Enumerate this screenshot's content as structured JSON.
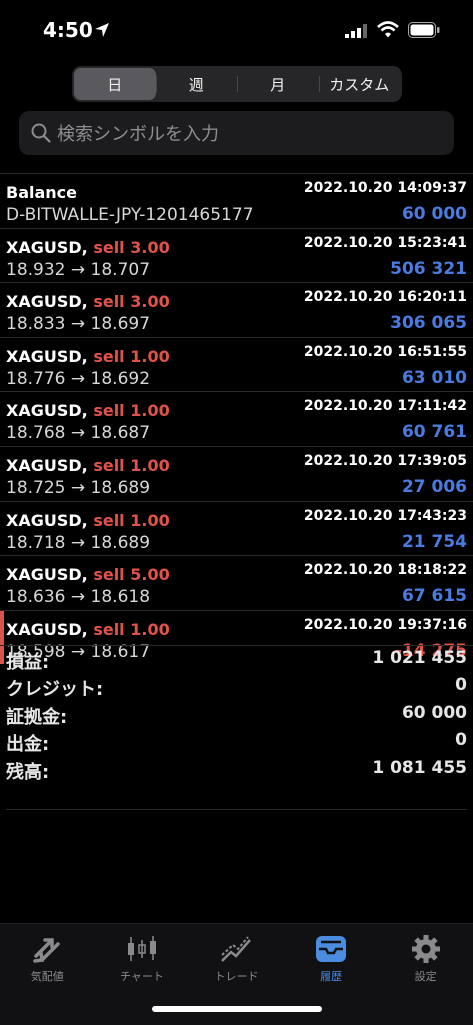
{
  "status": {
    "time": "4:50"
  },
  "period_tabs": [
    "日",
    "週",
    "月",
    "カスタム"
  ],
  "search": {
    "placeholder": "検索シンボルを入力"
  },
  "rows": [
    {
      "symbol": "Balance",
      "side": "",
      "detail": "D-BITWALLE-JPY-1201465177",
      "datetime": "2022.10.20 14:09:37",
      "value": "60 000",
      "sign": "pos"
    },
    {
      "symbol": "XAGUSD,",
      "side": "sell 3.00",
      "detail": "18.932 → 18.707",
      "datetime": "2022.10.20 15:23:41",
      "value": "506 321",
      "sign": "pos"
    },
    {
      "symbol": "XAGUSD,",
      "side": "sell 3.00",
      "detail": "18.833 → 18.697",
      "datetime": "2022.10.20 16:20:11",
      "value": "306 065",
      "sign": "pos"
    },
    {
      "symbol": "XAGUSD,",
      "side": "sell 1.00",
      "detail": "18.776 → 18.692",
      "datetime": "2022.10.20 16:51:55",
      "value": "63 010",
      "sign": "pos"
    },
    {
      "symbol": "XAGUSD,",
      "side": "sell 1.00",
      "detail": "18.768 → 18.687",
      "datetime": "2022.10.20 17:11:42",
      "value": "60 761",
      "sign": "pos"
    },
    {
      "symbol": "XAGUSD,",
      "side": "sell 1.00",
      "detail": "18.725 → 18.689",
      "datetime": "2022.10.20 17:39:05",
      "value": "27 006",
      "sign": "pos"
    },
    {
      "symbol": "XAGUSD,",
      "side": "sell 1.00",
      "detail": "18.718 → 18.689",
      "datetime": "2022.10.20 17:43:23",
      "value": "21 754",
      "sign": "pos"
    },
    {
      "symbol": "XAGUSD,",
      "side": "sell 5.00",
      "detail": "18.636 → 18.618",
      "datetime": "2022.10.20 18:18:22",
      "value": "67 615",
      "sign": "pos"
    },
    {
      "symbol": "XAGUSD,",
      "side": "sell 1.00",
      "detail": "18.598 → 18.617",
      "datetime": "2022.10.20 19:37:16",
      "value": "-14 275",
      "sign": "neg"
    }
  ],
  "summary": [
    {
      "label": "損益:",
      "value": "1 021 455"
    },
    {
      "label": "クレジット:",
      "value": "0"
    },
    {
      "label": "証拠金:",
      "value": "60 000"
    },
    {
      "label": "出金:",
      "value": "0"
    },
    {
      "label": "残高:",
      "value": "1 081 455"
    }
  ],
  "tabs": [
    "気配値",
    "チャート",
    "トレード",
    "履歴",
    "設定"
  ],
  "colors": {
    "positive": "#4a7be0",
    "negative": "#e0524a",
    "accent": "#4a8de0"
  }
}
